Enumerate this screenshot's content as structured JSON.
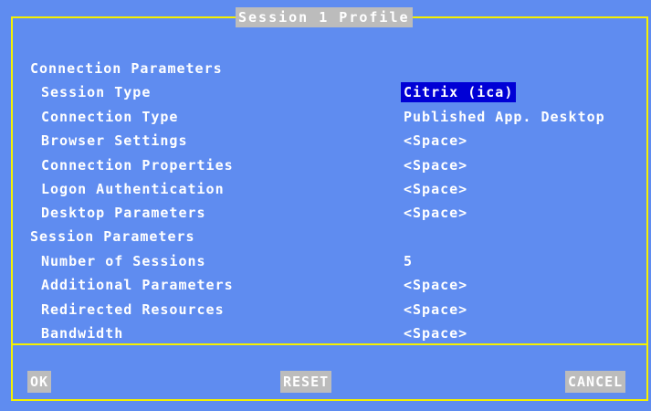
{
  "title": "Session 1 Profile",
  "connection_parameters": {
    "heading": "Connection Parameters",
    "items": [
      {
        "label": "Session Type",
        "value": "Citrix (ica)"
      },
      {
        "label": "Connection Type",
        "value": "Published App. Desktop"
      },
      {
        "label": "Browser Settings",
        "value": "<Space>"
      },
      {
        "label": "Connection Properties",
        "value": "<Space>"
      },
      {
        "label": "Logon Authentication",
        "value": "<Space>"
      },
      {
        "label": "Desktop Parameters",
        "value": "<Space>"
      }
    ]
  },
  "session_parameters": {
    "heading": "Session Parameters",
    "items": [
      {
        "label": "Number of Sessions",
        "value": "5"
      },
      {
        "label": "Additional Parameters",
        "value": "<Space>"
      },
      {
        "label": "Redirected Resources",
        "value": "<Space>"
      },
      {
        "label": "Bandwidth",
        "value": "<Space>"
      }
    ]
  },
  "buttons": {
    "ok": "OK",
    "reset": "RESET",
    "cancel": "CANCEL"
  },
  "colors": {
    "background": "#5f8cf0",
    "border": "#f5f100",
    "selected": "#0000d6",
    "button": "#bcbcbc"
  }
}
